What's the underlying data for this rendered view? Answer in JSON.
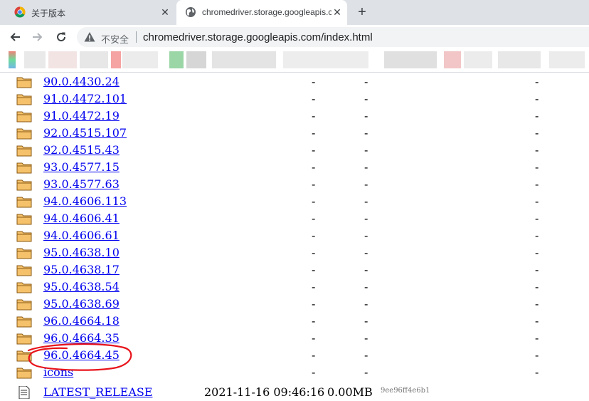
{
  "tabs": [
    {
      "title": "关于版本",
      "close": "✕",
      "favicon": "chrome-logo-icon"
    },
    {
      "title": "chromedriver.storage.googleapis.com/index.html",
      "close": "✕",
      "favicon": "globe-icon"
    }
  ],
  "toolbar": {
    "new_tab": "+",
    "security_label": "不安全",
    "url": "chromedriver.storage.googleapis.com/index.html"
  },
  "listing": {
    "rows": [
      {
        "name": "90.0.4430.24",
        "c1": "-",
        "c2": "-",
        "c3": "-"
      },
      {
        "name": "91.0.4472.101",
        "c1": "-",
        "c2": "-",
        "c3": "-"
      },
      {
        "name": "91.0.4472.19",
        "c1": "-",
        "c2": "-",
        "c3": "-"
      },
      {
        "name": "92.0.4515.107",
        "c1": "-",
        "c2": "-",
        "c3": "-"
      },
      {
        "name": "92.0.4515.43",
        "c1": "-",
        "c2": "-",
        "c3": "-"
      },
      {
        "name": "93.0.4577.15",
        "c1": "-",
        "c2": "-",
        "c3": "-"
      },
      {
        "name": "93.0.4577.63",
        "c1": "-",
        "c2": "-",
        "c3": "-"
      },
      {
        "name": "94.0.4606.113",
        "c1": "-",
        "c2": "-",
        "c3": "-"
      },
      {
        "name": "94.0.4606.41",
        "c1": "-",
        "c2": "-",
        "c3": "-"
      },
      {
        "name": "94.0.4606.61",
        "c1": "-",
        "c2": "-",
        "c3": "-"
      },
      {
        "name": "95.0.4638.10",
        "c1": "-",
        "c2": "-",
        "c3": "-"
      },
      {
        "name": "95.0.4638.17",
        "c1": "-",
        "c2": "-",
        "c3": "-"
      },
      {
        "name": "95.0.4638.54",
        "c1": "-",
        "c2": "-",
        "c3": "-"
      },
      {
        "name": "95.0.4638.69",
        "c1": "-",
        "c2": "-",
        "c3": "-"
      },
      {
        "name": "96.0.4664.18",
        "c1": "-",
        "c2": "-",
        "c3": "-"
      },
      {
        "name": "96.0.4664.35",
        "c1": "-",
        "c2": "-",
        "c3": "-"
      },
      {
        "name": "96.0.4664.45",
        "c1": "-",
        "c2": "-",
        "c3": "-"
      },
      {
        "name": "icons",
        "c1": "-",
        "c2": "-",
        "c3": "-"
      }
    ],
    "last": {
      "name": "LATEST_RELEASE",
      "date": "2021-11-16 09:46:16",
      "size": "0.00MB",
      "hash": "9ee96ff4e6b1"
    }
  },
  "colors": {
    "link": "#0000ee",
    "folder_fill": "#f5c26b",
    "annotation": "#e8141b",
    "tabstrip": "#dee1e6"
  },
  "icons": {
    "folder": "folder-icon",
    "file": "file-icon",
    "back": "back-arrow-icon",
    "forward": "forward-arrow-icon",
    "reload": "reload-icon",
    "warning": "warning-icon"
  }
}
